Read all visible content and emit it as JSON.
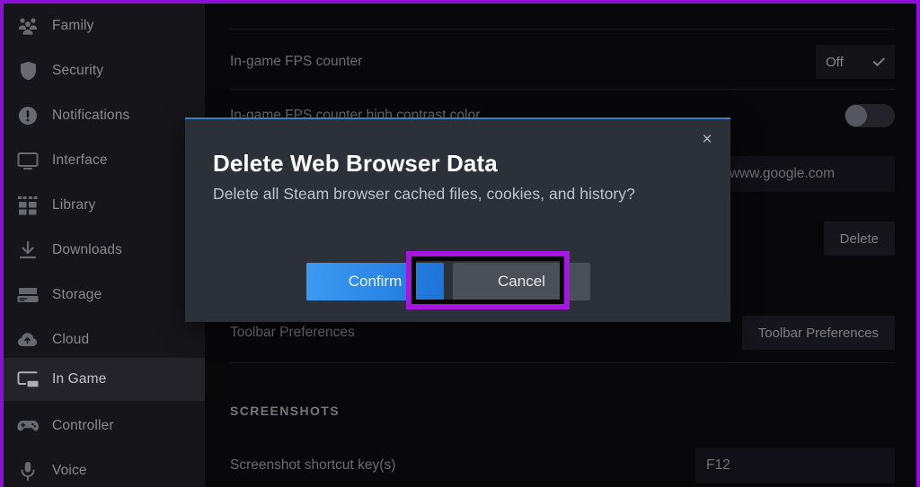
{
  "theme": {
    "accent_purple": "#8b0fd4",
    "highlight_purple": "#a715e0",
    "confirm_blue": "#2f8ae8",
    "modal_bg": "#2c3039",
    "modal_top_border": "#3d7ecb",
    "sidebar_bg": "#16161a",
    "content_bg": "#08080a"
  },
  "sidebar": {
    "items": [
      {
        "label": "Family",
        "icon": "family-icon",
        "selected": false
      },
      {
        "label": "Security",
        "icon": "shield-icon",
        "selected": false
      },
      {
        "label": "Notifications",
        "icon": "notification-icon",
        "selected": false
      },
      {
        "label": "Interface",
        "icon": "monitor-icon",
        "selected": false
      },
      {
        "label": "Library",
        "icon": "grid-icon",
        "selected": false
      },
      {
        "label": "Downloads",
        "icon": "download-icon",
        "selected": false
      },
      {
        "label": "Storage",
        "icon": "drive-icon",
        "selected": false
      },
      {
        "label": "Cloud",
        "icon": "cloud-icon",
        "selected": false
      },
      {
        "label": "In Game",
        "icon": "in-game-icon",
        "selected": true
      },
      {
        "label": "Controller",
        "icon": "gamepad-icon",
        "selected": false
      },
      {
        "label": "Voice",
        "icon": "microphone-icon",
        "selected": false
      }
    ]
  },
  "settings": {
    "rows": {
      "fps_counter": {
        "label": "In-game FPS counter",
        "value": "Off"
      },
      "fps_high_contrast": {
        "label": "In-game FPS counter high contrast color",
        "toggle_state": "off"
      },
      "home_page": {
        "value": "tp://www.google.com"
      },
      "delete_button": "Delete",
      "toolbar_preferences": {
        "label": "Toolbar Preferences",
        "button": "Toolbar Preferences"
      },
      "screenshots_header": "SCREENSHOTS",
      "screenshot_shortcut": {
        "label": "Screenshot shortcut key(s)",
        "value": "F12"
      }
    }
  },
  "modal": {
    "title": "Delete Web Browser Data",
    "message": "Delete all Steam browser cached files, cookies, and history?",
    "confirm_label": "Confirm",
    "cancel_label": "Cancel",
    "close_icon": "×"
  }
}
